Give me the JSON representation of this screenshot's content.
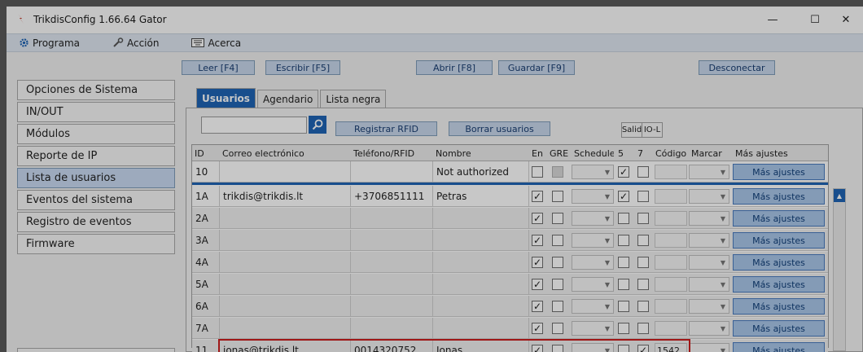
{
  "window": {
    "title": "TrikdisConfig 1.66.64   Gator",
    "controls": {
      "minimize": "—",
      "maximize": "☐",
      "close": "✕"
    }
  },
  "menubar": {
    "items": [
      {
        "label": "Programa",
        "icon": "gear-icon"
      },
      {
        "label": "Acción",
        "icon": "wrench-icon"
      },
      {
        "label": "Acerca",
        "icon": "keyboard-icon"
      }
    ]
  },
  "toolbar": {
    "leer": "Leer [F4]",
    "escribir": "Escribir [F5]",
    "abrir": "Abrir [F8]",
    "guardar": "Guardar [F9]",
    "desconectar": "Desconectar"
  },
  "sidebar": {
    "items": [
      {
        "label": "Opciones de Sistema"
      },
      {
        "label": "IN/OUT"
      },
      {
        "label": "Módulos"
      },
      {
        "label": "Reporte de IP"
      },
      {
        "label": "Lista de usuarios",
        "active": true
      },
      {
        "label": "Eventos del sistema"
      },
      {
        "label": "Registro de eventos"
      },
      {
        "label": "Firmware"
      }
    ]
  },
  "tabs": [
    {
      "label": "Usuarios",
      "active": true
    },
    {
      "label": "Agendario"
    },
    {
      "label": "Lista negra"
    }
  ],
  "actions": {
    "search_placeholder": "",
    "registrar": "Registrar RFID",
    "borrar": "Borrar usuarios",
    "salida_header": "Salid",
    "iol_header": "IO-L"
  },
  "table": {
    "headers": {
      "id": "ID",
      "email": "Correo electrónico",
      "phone": "Teléfono/RFID",
      "name": "Nombre",
      "en": "En",
      "gre": "GRE",
      "schedule": "Schedule",
      "c5": "5",
      "c7": "7",
      "codigo": "Código",
      "marcar": "Marcar",
      "mas": "Más ajustes"
    },
    "mas_label": "Más ajustes",
    "rows": [
      {
        "id": "10",
        "email": "",
        "phone": "",
        "name": "Not authorized",
        "en": "",
        "gre": "",
        "c5": "✓",
        "c7": "",
        "codigo": ""
      },
      {
        "id": "1A",
        "email": "trikdis@trikdis.lt",
        "phone": "+3706851111",
        "name": "Petras",
        "en": "✓",
        "gre": "",
        "c5": "✓",
        "c7": "",
        "codigo": ""
      },
      {
        "id": "2A",
        "email": "",
        "phone": "",
        "name": "",
        "en": "✓",
        "gre": "",
        "c5": "",
        "c7": "",
        "codigo": ""
      },
      {
        "id": "3A",
        "email": "",
        "phone": "",
        "name": "",
        "en": "✓",
        "gre": "",
        "c5": "",
        "c7": "",
        "codigo": ""
      },
      {
        "id": "4A",
        "email": "",
        "phone": "",
        "name": "",
        "en": "✓",
        "gre": "",
        "c5": "",
        "c7": "",
        "codigo": ""
      },
      {
        "id": "5A",
        "email": "",
        "phone": "",
        "name": "",
        "en": "✓",
        "gre": "",
        "c5": "",
        "c7": "",
        "codigo": ""
      },
      {
        "id": "6A",
        "email": "",
        "phone": "",
        "name": "",
        "en": "✓",
        "gre": "",
        "c5": "",
        "c7": "",
        "codigo": ""
      },
      {
        "id": "7A",
        "email": "",
        "phone": "",
        "name": "",
        "en": "✓",
        "gre": "",
        "c5": "",
        "c7": "",
        "codigo": ""
      },
      {
        "id": "11",
        "email": "jonas@trikdis.lt",
        "phone": "0014320752",
        "name": "Jonas",
        "en": "✓",
        "gre": "",
        "c5": "",
        "c7": "✓",
        "codigo": "1542"
      }
    ]
  },
  "colors": {
    "accent": "#1f64b5",
    "highlight": "#cc1e1e",
    "button_bg": "#c8d8ec"
  }
}
